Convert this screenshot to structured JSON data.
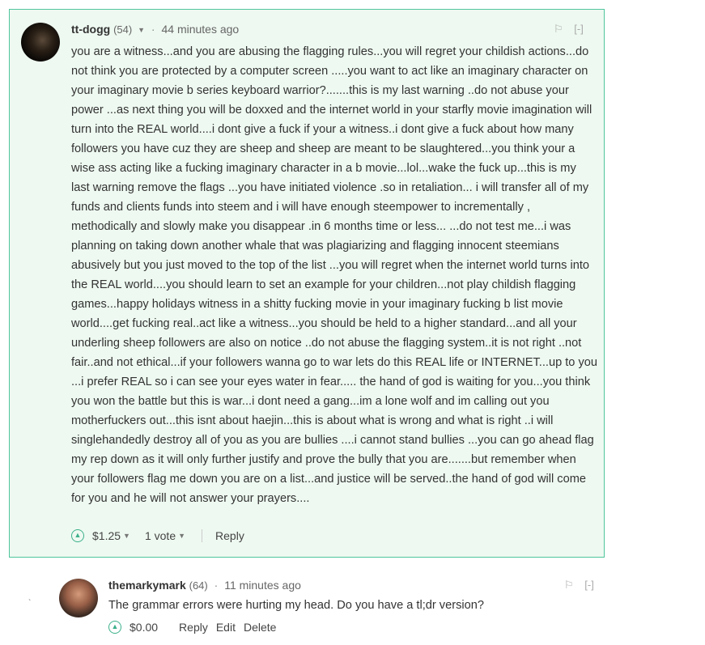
{
  "comment1": {
    "author": "tt-dogg",
    "reputation": "(54)",
    "separator": "·",
    "time": "44 minutes ago",
    "collapse": "[-]",
    "body": "you are a witness...and you are abusing the flagging rules...you will regret your childish actions...do not think you are protected by a computer screen .....you want to act like an imaginary character on your imaginary movie b series keyboard warrior?.......this is my last warning ..do not abuse your power ...as next thing you will be doxxed and the internet world in your starfly movie imagination will turn into the REAL world....i dont give a fuck if your a witness..i dont give a fuck about how many followers you have cuz they are sheep and sheep are meant to be slaughtered...you think your a wise ass acting like a fucking imaginary character in a b movie...lol...wake the fuck up...this is my last warning remove the flags ...you have initiated violence .so in retaliation... i will transfer all of my funds and clients funds into steem and i will have enough steempower to incrementally , methodically and slowly make you disappear .in 6 months time or less... ...do not test me...i was planning on taking down another whale that was plagiarizing and flagging innocent steemians abusively but you just moved to the top of the list ...you will regret when the internet world turns into the REAL world....you should learn to set an example for your children...not play childish flagging games...happy holidays witness in a shitty fucking movie in your imaginary fucking b list movie world....get fucking real..act like a witness...you should be held to a higher standard...and all your underling sheep followers are also on notice ..do not abuse the flagging system..it is not right ..not fair..and not ethical...if your followers wanna go to war lets do this REAL life or INTERNET...up to you ...i prefer REAL so i can see your eyes water in fear..... the hand of god is waiting for you...you think you won the battle but this is war...i dont need a gang...im a lone wolf and im calling out you motherfuckers out...this isnt about haejin...this is about what is wrong and what is right ..i will singlehandedly destroy all of you as you are bullies ....i cannot stand bullies ...you can go ahead flag my rep down as it will only further justify and prove the bully that you are.......but remember when your followers flag me down you are on a list...and justice will be served..the hand of god will come for you and he will not answer your prayers....",
    "payout": "$1.25",
    "votes": "1 vote",
    "reply": "Reply"
  },
  "comment2": {
    "author": "themarkymark",
    "reputation": "(64)",
    "separator": "·",
    "time": "11 minutes ago",
    "collapse": "[-]",
    "body": "The grammar errors were hurting my head. Do you have a tl;dr version?",
    "payout": "$0.00",
    "reply": "Reply",
    "edit": "Edit",
    "delete": "Delete"
  },
  "icons": {
    "flag": "flag-icon",
    "upvote": "upvote-icon",
    "dropdown": "chevron-down-icon"
  },
  "colors": {
    "highlight_bg": "#eef9f1",
    "highlight_border": "#4fc59e",
    "upvote": "#3cb08b"
  }
}
